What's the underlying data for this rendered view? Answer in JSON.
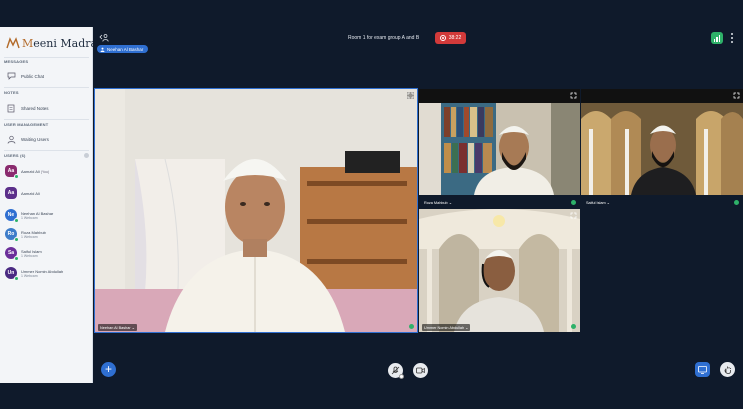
{
  "app": {
    "logo_text_a": "M",
    "logo_text_b": "eeni Madrasa"
  },
  "sidebar": {
    "sections": {
      "messages": "MESSAGES",
      "notes": "NOTES",
      "user_management": "USER MANAGEMENT",
      "users": "USERS (6)"
    },
    "public_chat": "Public Chat",
    "shared_notes": "Shared Notes",
    "waiting_users": "Waiting Users",
    "users": [
      {
        "initials": "Aa",
        "name": "Aamzid Ali",
        "tag": "(You)",
        "sub": "",
        "color": "#8a2b6e",
        "badge": "#2eb169"
      },
      {
        "initials": "Aa",
        "name": "Aamzid Ali",
        "tag": "",
        "sub": "",
        "color": "#5b2f8a",
        "badge": ""
      },
      {
        "initials": "Ne",
        "name": "Neehan Al Bashar",
        "tag": "",
        "sub": "1 Webcam",
        "color": "#2f6fd1",
        "badge": "#2eb169"
      },
      {
        "initials": "Ro",
        "name": "Roza Mahbub",
        "tag": "",
        "sub": "1 Webcam",
        "color": "#3d7cc9",
        "badge": "#2eb169"
      },
      {
        "initials": "Sa",
        "name": "Saiful Islam",
        "tag": "",
        "sub": "1 Webcam",
        "color": "#6b2f9a",
        "badge": "#2eb169"
      },
      {
        "initials": "Un",
        "name": "Ummer Nomin Abdullah",
        "tag": "",
        "sub": "1 Webcam",
        "color": "#4a2a82",
        "badge": "#2eb169"
      }
    ]
  },
  "header": {
    "presenter": "Neehan Al Bashar",
    "room_title": "Room 1 for exam group A and B",
    "timer": "38:22"
  },
  "videos": [
    {
      "id": "main",
      "label": "Neehan Al Bashar"
    },
    {
      "id": "roza",
      "label": "Roza Mahbub"
    },
    {
      "id": "saiful",
      "label": "Saiful Islam"
    },
    {
      "id": "ummer",
      "label": "Ummer Nomin Abdullah"
    }
  ],
  "colors": {
    "accent": "#2f6fd1",
    "record": "#d23a3a",
    "online": "#2eb169",
    "background": "#0f1a2b"
  }
}
